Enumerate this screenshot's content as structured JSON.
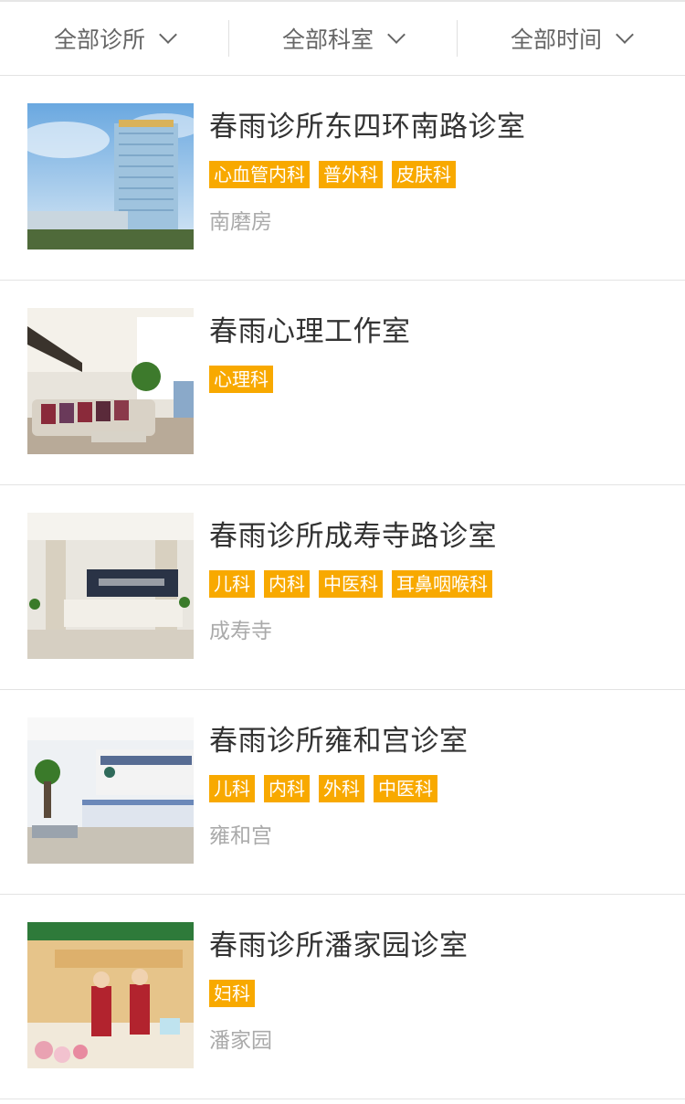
{
  "filters": [
    {
      "label": "全部诊所"
    },
    {
      "label": "全部科室"
    },
    {
      "label": "全部时间"
    }
  ],
  "clinics": [
    {
      "name": "春雨诊所东四环南路诊室",
      "tags": [
        "心血管内科",
        "普外科",
        "皮肤科"
      ],
      "location": "南磨房",
      "image": "building-photo"
    },
    {
      "name": "春雨心理工作室",
      "tags": [
        "心理科"
      ],
      "location": "",
      "image": "lounge-photo"
    },
    {
      "name": "春雨诊所成寿寺路诊室",
      "tags": [
        "儿科",
        "内科",
        "中医科",
        "耳鼻咽喉科"
      ],
      "location": "成寿寺",
      "image": "reception-photo"
    },
    {
      "name": "春雨诊所雍和宫诊室",
      "tags": [
        "儿科",
        "内科",
        "外科",
        "中医科"
      ],
      "location": "雍和宫",
      "image": "hospital-lobby-photo"
    },
    {
      "name": "春雨诊所潘家园诊室",
      "tags": [
        "妇科"
      ],
      "location": "潘家园",
      "image": "staff-reception-photo"
    }
  ],
  "colors": {
    "tag_bg": "#f8a900",
    "title": "#333333",
    "location": "#aaaaaa",
    "filter_text": "#666666"
  }
}
